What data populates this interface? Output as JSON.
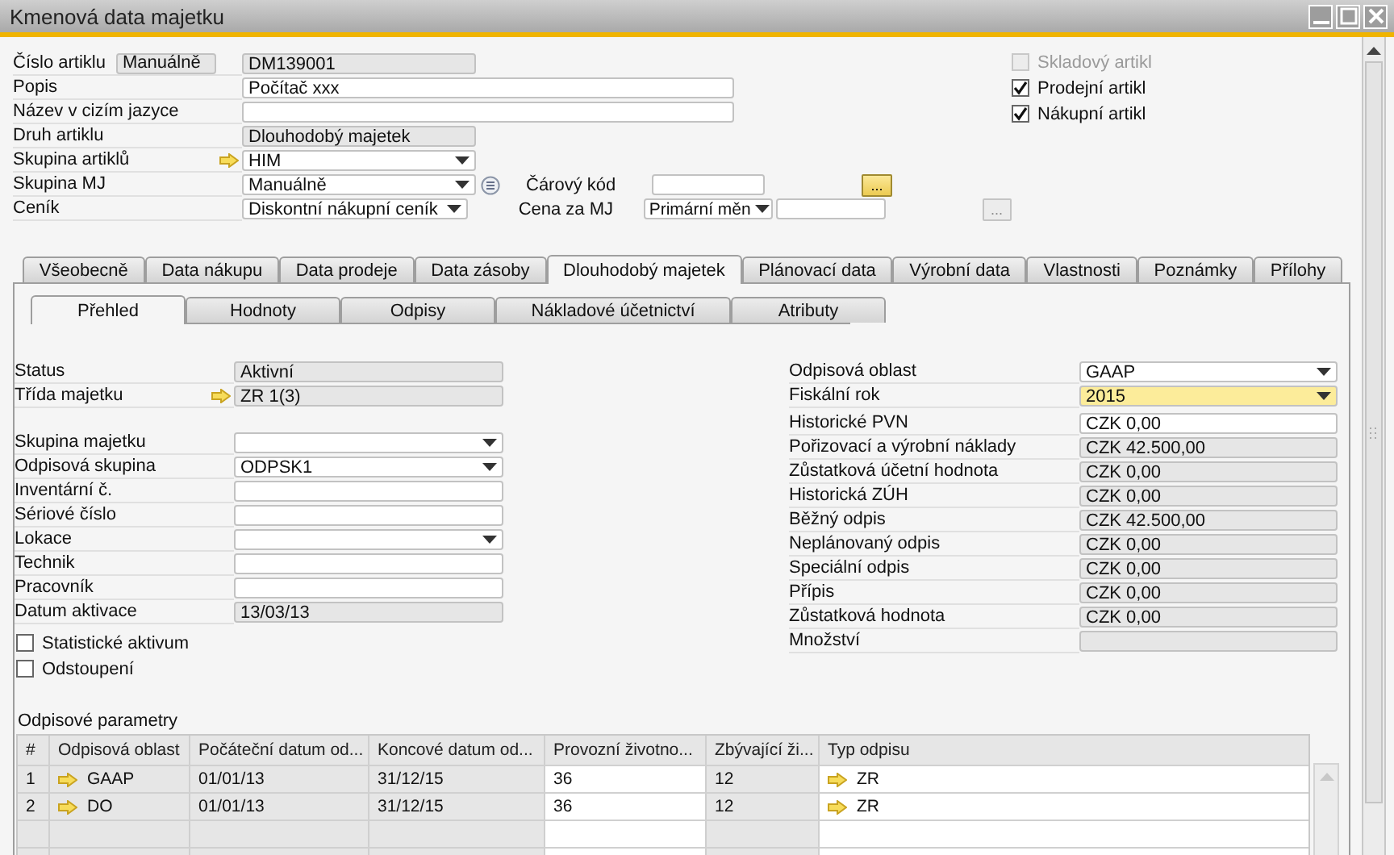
{
  "window": {
    "title": "Kmenová data majetku"
  },
  "header": {
    "rows": [
      {
        "label": "Číslo artiklu",
        "prefix": "Manuálně",
        "kind": "readonly",
        "value": "DM139001",
        "linked": false,
        "detail_icon": false
      },
      {
        "label": "Popis",
        "kind": "input",
        "value": "Počítač xxx",
        "linked": false,
        "detail_icon": false
      },
      {
        "label": "Název v cizím jazyce",
        "kind": "input",
        "linked": false,
        "detail_icon": false
      },
      {
        "label": "Druh artiklu",
        "kind": "readonly",
        "value": "Dlouhodobý majetek",
        "linked": false,
        "detail_icon": false
      },
      {
        "label": "Skupina artiklů",
        "kind": "dropdown",
        "value": "HIM",
        "linked": true,
        "detail_icon": false
      },
      {
        "label": "Skupina MJ",
        "kind": "dropdown",
        "value": "Manuálně",
        "linked": false,
        "detail_icon": true,
        "side": {
          "label": "Čárový kód",
          "button": {
            "text": "...",
            "disabled": false
          }
        }
      },
      {
        "label": "Ceník",
        "kind": "dropdown",
        "value": "Diskontní nákupní ceník",
        "linked": false,
        "detail_icon": false,
        "side": {
          "label": "Cena za MJ",
          "currency": "Primární měn",
          "button": {
            "text": "...",
            "disabled": true
          }
        }
      }
    ],
    "checks": [
      {
        "label": "Skladový artikl",
        "checked": false,
        "disabled": true
      },
      {
        "label": "Prodejní artikl",
        "checked": true,
        "disabled": false
      },
      {
        "label": "Nákupní artikl",
        "checked": true,
        "disabled": false
      }
    ]
  },
  "tabs": [
    {
      "label": "Všeobecně",
      "selected": false
    },
    {
      "label": "Data nákupu",
      "selected": false
    },
    {
      "label": "Data prodeje",
      "selected": false
    },
    {
      "label": "Data zásoby",
      "selected": false
    },
    {
      "label": "Dlouhodobý majetek",
      "selected": true
    },
    {
      "label": "Plánovací data",
      "selected": false
    },
    {
      "label": "Výrobní data",
      "selected": false
    },
    {
      "label": "Vlastnosti",
      "selected": false
    },
    {
      "label": "Poznámky",
      "selected": false
    },
    {
      "label": "Přílohy",
      "selected": false
    }
  ],
  "subtabs": [
    {
      "label": "Přehled",
      "selected": true
    },
    {
      "label": "Hodnoty",
      "selected": false
    },
    {
      "label": "Odpisy",
      "selected": false
    },
    {
      "label": "Nákladové účetnictví",
      "selected": false
    },
    {
      "label": "Atributy",
      "selected": false
    }
  ],
  "overview": {
    "left": [
      [
        {
          "label": "Status",
          "kind": "readonly",
          "value": "Aktivní",
          "linked": false,
          "focused": false
        },
        {
          "label": "Třída majetku",
          "kind": "readonly",
          "value": "ZR 1(3)",
          "linked": true,
          "focused": false
        }
      ],
      [
        {
          "label": "Skupina majetku",
          "kind": "dropdown",
          "linked": false,
          "focused": false
        },
        {
          "label": "Odpisová skupina",
          "kind": "dropdown",
          "value": "ODPSK1",
          "linked": false,
          "focused": false
        },
        {
          "label": "Inventární č.",
          "kind": "input",
          "linked": false,
          "focused": false
        },
        {
          "label": "Sériové číslo",
          "kind": "input",
          "linked": false,
          "focused": false
        },
        {
          "label": "Lokace",
          "kind": "dropdown",
          "linked": false,
          "focused": false
        },
        {
          "label": "Technik",
          "kind": "input",
          "linked": false,
          "focused": false
        },
        {
          "label": "Pracovník",
          "kind": "input",
          "linked": false,
          "focused": false
        },
        {
          "label": "Datum aktivace",
          "kind": "readonly",
          "value": "13/03/13",
          "linked": false,
          "focused": false
        }
      ]
    ],
    "right": [
      [
        {
          "label": "Odpisová oblast",
          "kind": "dropdown",
          "value": "GAAP",
          "linked": false,
          "focused": false
        },
        {
          "label": "Fiskální rok",
          "kind": "dropdown",
          "value": "2015",
          "linked": false,
          "focused": true
        }
      ],
      [
        {
          "label": "Historické PVN",
          "kind": "input",
          "value": "CZK 0,00",
          "linked": false,
          "focused": false
        },
        {
          "label": "Pořizovací a výrobní náklady",
          "kind": "readonly",
          "value": "CZK 42.500,00",
          "linked": false,
          "focused": false
        },
        {
          "label": "Zůstatková účetní hodnota",
          "kind": "readonly",
          "value": "CZK 0,00",
          "linked": false,
          "focused": false
        },
        {
          "label": "Historická ZÚH",
          "kind": "readonly",
          "value": "CZK 0,00",
          "linked": false,
          "focused": false
        },
        {
          "label": "Běžný odpis",
          "kind": "readonly",
          "value": "CZK 42.500,00",
          "linked": false,
          "focused": false
        },
        {
          "label": "Neplánovaný odpis",
          "kind": "readonly",
          "value": "CZK 0,00",
          "linked": false,
          "focused": false
        },
        {
          "label": "Speciální odpis",
          "kind": "readonly",
          "value": "CZK 0,00",
          "linked": false,
          "focused": false
        },
        {
          "label": "Přípis",
          "kind": "readonly",
          "value": "CZK 0,00",
          "linked": false,
          "focused": false
        },
        {
          "label": "Zůstatková hodnota",
          "kind": "readonly",
          "value": "CZK 0,00",
          "linked": false,
          "focused": false
        },
        {
          "label": "Množství",
          "kind": "readonly",
          "linked": false,
          "focused": false
        }
      ]
    ],
    "flags": [
      {
        "label": "Statistické aktivum",
        "checked": false
      },
      {
        "label": "Odstoupení",
        "checked": false
      }
    ]
  },
  "depreciation": {
    "title": "Odpisové parametry",
    "columns": [
      {
        "label": "#",
        "kind": "plain"
      },
      {
        "label": "Odpisová oblast",
        "kind": "linked"
      },
      {
        "label": "Počáteční datum od...",
        "kind": "plain"
      },
      {
        "label": "Koncové datum od...",
        "kind": "plain"
      },
      {
        "label": "Provozní životno...",
        "kind": "editable"
      },
      {
        "label": "Zbývající ži...",
        "kind": "plain"
      },
      {
        "label": "Typ odpisu",
        "kind": "linked_editable"
      }
    ],
    "rows": [
      [
        "1",
        "GAAP",
        "01/01/13",
        "31/12/15",
        "36",
        "12",
        "ZR"
      ],
      [
        "2",
        "DO",
        "01/01/13",
        "31/12/15",
        "36",
        "12",
        "ZR"
      ]
    ]
  }
}
